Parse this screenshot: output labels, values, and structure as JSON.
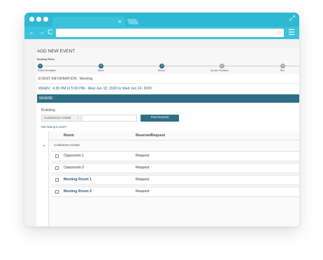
{
  "browser": {
    "nav_back": "←",
    "nav_forward": "→",
    "nav_reload": "C",
    "tab_close": "×",
    "bookmark_star": "☆",
    "menu": "☰",
    "expand": "⤢"
  },
  "page": {
    "title": "ADD NEW EVENT",
    "booking_rules": "Booking Rules",
    "steps": [
      {
        "number": "1",
        "label": "Event Information",
        "active": true
      },
      {
        "number": "2",
        "label": "When",
        "active": true
      },
      {
        "number": "3",
        "label": "Where",
        "active": true
      },
      {
        "number": "4",
        "label": "Service Providers",
        "active": false
      },
      {
        "number": "5",
        "label": "Res",
        "active": false
      }
    ]
  },
  "event": {
    "info_title": "EVENT INFORMATION : Meeting",
    "when": "WHEN : 4:30 PM to 5:00 PM - Wed Jun 10, 2020 to Wed Jun 24, 2020"
  },
  "where": {
    "header": "WHERE",
    "building_label": "Building",
    "building_value": "Conference Center",
    "building_clear": "×",
    "find_button": "Find Rooms",
    "not_seeing": "Not seeing a room?"
  },
  "rooms_table": {
    "columns": [
      "Room",
      "Reserve/Request"
    ],
    "group_caret": "▼",
    "group_label": "Conference Center",
    "rows": [
      {
        "room": "Classroom 1",
        "action": "Request"
      },
      {
        "room": "Classroom 2",
        "action": "Request"
      },
      {
        "room": "Meeting Room 1",
        "action": "Request"
      },
      {
        "room": "Meeting Room 2",
        "action": "Request"
      }
    ]
  },
  "colors": {
    "browser_chrome": "#2fb8d3",
    "accent": "#2e6f86",
    "link": "#2c5f7c"
  }
}
